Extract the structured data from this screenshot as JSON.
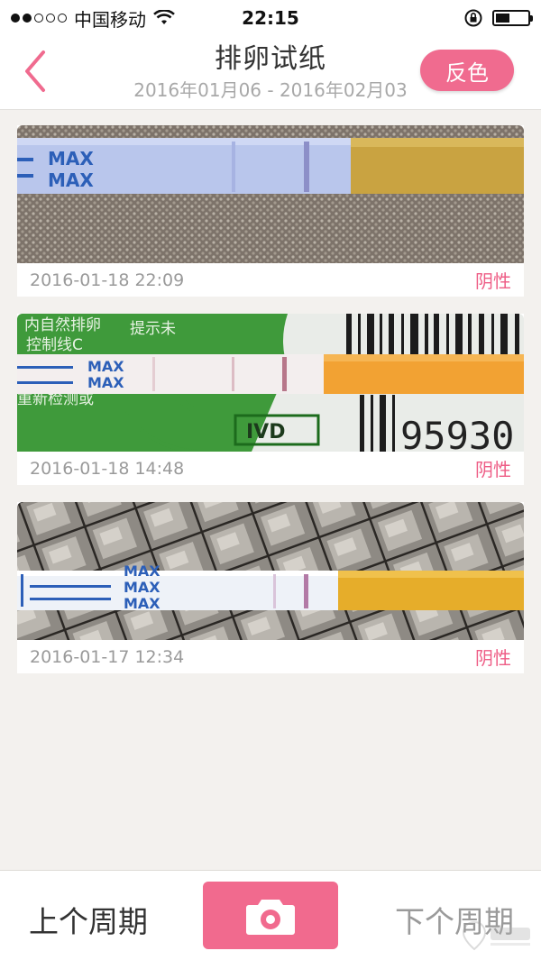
{
  "status_bar": {
    "carrier": "中国移动",
    "time": "22:15"
  },
  "nav": {
    "title": "排卵试纸",
    "subtitle": "2016年01月06 - 2016年02月03",
    "invert_label": "反色"
  },
  "records": [
    {
      "datetime": "2016-01-18 22:09",
      "result": "阴性",
      "strip_text": [
        "MAX",
        "MAX"
      ]
    },
    {
      "datetime": "2016-01-18 14:48",
      "result": "阴性",
      "strip_text": [
        "MAX",
        "MAX"
      ],
      "packaging_text": [
        "内自然排卵",
        "提示未",
        "控制线C",
        "重新检测或",
        "IVD",
        "95930"
      ]
    },
    {
      "datetime": "2016-01-17 12:34",
      "result": "阴性",
      "strip_text": [
        "MAX",
        "MAX",
        "MAX"
      ]
    }
  ],
  "toolbar": {
    "prev_label": "上个周期",
    "next_label": "下个周期",
    "camera_icon": "camera-icon"
  },
  "colors": {
    "accent": "#f06b8f",
    "negative_text": "#ee5d86",
    "background": "#f3f1ee"
  }
}
